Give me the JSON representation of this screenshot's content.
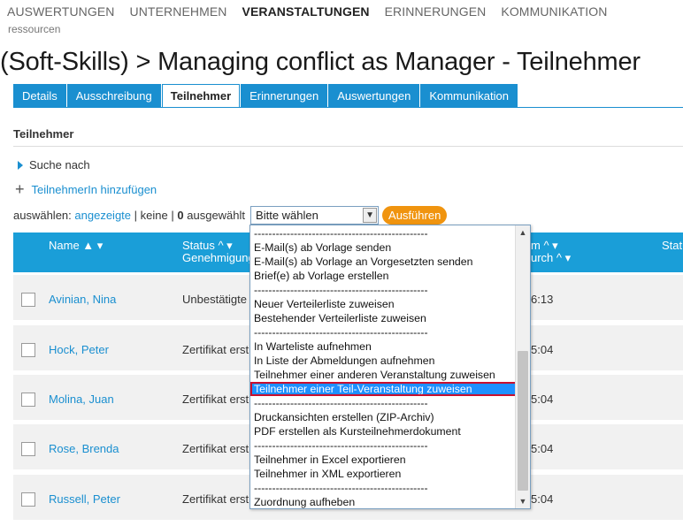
{
  "topnav": [
    "AUSWERTUNGEN",
    "UNTERNEHMEN",
    "VERANSTALTUNGEN",
    "ERINNERUNGEN",
    "KOMMUNIKATION"
  ],
  "subnav": "ressourcen",
  "page_title": "(Soft-Skills) > Managing conflict as Manager - Teilnehmer",
  "tabs": [
    "Details",
    "Ausschreibung",
    "Teilnehmer",
    "Erinnerungen",
    "Auswertungen",
    "Kommunikation"
  ],
  "section_title": "Teilnehmer",
  "search_toggle": "Suche nach",
  "add_user": "TeilnehmerIn hinzufügen",
  "selection": {
    "prefix": "auswählen:",
    "shown": "angezeigte",
    "sep1": "|",
    "none": "keine",
    "sep2": "|",
    "count": "0",
    "selected_suffix": "ausgewählt",
    "select_value": "Bitte wählen",
    "run_label": "Ausführen"
  },
  "table": {
    "headers": {
      "name": "Name ▲ ▾",
      "status_line1": "Status ^ ▾",
      "status_line2": "Genehmigung",
      "date_line1": "m ^ ▾",
      "date_line2": "urch ^ ▾",
      "status_right": "Statu"
    },
    "rows": [
      {
        "name": "Avinian, Nina",
        "status": "Unbestätigte",
        "time": "6:13"
      },
      {
        "name": "Hock, Peter",
        "status": "Zertifikat erst",
        "time": "5:04"
      },
      {
        "name": "Molina, Juan",
        "status": "Zertifikat erst",
        "time": "5:04"
      },
      {
        "name": "Rose, Brenda",
        "status": "Zertifikat erst",
        "time": "5:04"
      },
      {
        "name": "Russell, Peter",
        "status": "Zertifikat erst",
        "time": "5:04"
      }
    ]
  },
  "dropdown": {
    "items": [
      "------------------------------------------------",
      "E-Mail(s) ab Vorlage senden",
      "E-Mail(s) ab Vorlage an Vorgesetzten senden",
      "Brief(e) ab Vorlage erstellen",
      "------------------------------------------------",
      "Neuer Verteilerliste zuweisen",
      "Bestehender Verteilerliste zuweisen",
      "------------------------------------------------",
      "In Warteliste aufnehmen",
      "In Liste der Abmeldungen aufnehmen",
      "Teilnehmer einer anderen Veranstaltung zuweisen",
      "Teilnehmer einer Teil-Veranstaltung zuweisen",
      "------------------------------------------------",
      "Druckansichten erstellen (ZIP-Archiv)",
      "PDF erstellen als Kursteilnehmerdokument",
      "------------------------------------------------",
      "Teilnehmer in Excel exportieren",
      "Teilnehmer in XML exportieren",
      "------------------------------------------------",
      "Zuordnung aufheben"
    ],
    "selected_index": 11
  }
}
